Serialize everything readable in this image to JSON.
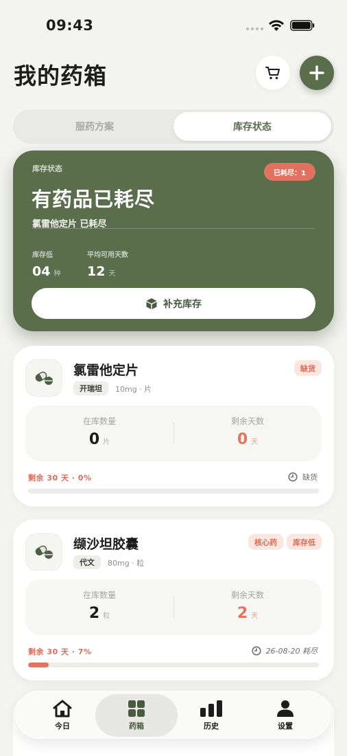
{
  "status_bar": {
    "time": "09:43"
  },
  "header": {
    "title": "我的药箱",
    "cart_icon": "cart-icon",
    "add_icon": "plus-icon"
  },
  "segmented": {
    "tabs": [
      "服药方案",
      "库存状态"
    ],
    "active_index": 1
  },
  "summary": {
    "label": "库存状态",
    "badge": "已耗尽：1",
    "headline": "有药品已耗尽",
    "subtext": "氯雷他定片 已耗尽",
    "stats": [
      {
        "label": "库存低",
        "value": "04",
        "unit": "种"
      },
      {
        "label": "平均可用天数",
        "value": "12",
        "unit": "天"
      }
    ],
    "button_label": "补充库存"
  },
  "medicines": [
    {
      "name": "氯雷他定片",
      "brand": "开瑞坦",
      "spec": "10mg · 片",
      "badges": [
        "缺货"
      ],
      "stock_label": "在库数量",
      "stock_value": "0",
      "stock_unit": "片",
      "days_label": "剩余天数",
      "days_value": "0",
      "days_unit": "天",
      "remain_text": "剩余 30 天 · 0%",
      "progress_percent": 0,
      "status_text": "缺货"
    },
    {
      "name": "缬沙坦胶囊",
      "brand": "代文",
      "spec": "80mg · 粒",
      "badges": [
        "核心药",
        "库存低"
      ],
      "stock_label": "在库数量",
      "stock_value": "2",
      "stock_unit": "粒",
      "days_label": "剩余天数",
      "days_value": "2",
      "days_unit": "天",
      "remain_text": "剩余 30 天 · 7%",
      "progress_percent": 7,
      "status_text": "26-08-20 耗尽"
    }
  ],
  "tab_bar": {
    "items": [
      {
        "label": "今日",
        "icon": "home-icon"
      },
      {
        "label": "药箱",
        "icon": "grid-icon"
      },
      {
        "label": "历史",
        "icon": "bar-chart-icon"
      },
      {
        "label": "设置",
        "icon": "person-icon"
      }
    ],
    "active_index": 1
  },
  "colors": {
    "accent": "#5a6e4c",
    "alert": "#e07560",
    "background": "#f4f4f1"
  }
}
